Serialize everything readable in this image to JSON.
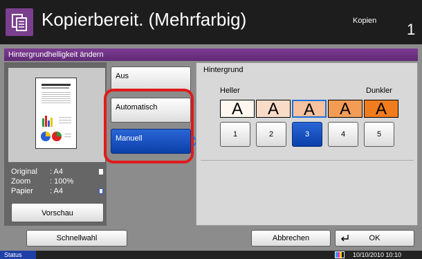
{
  "header": {
    "title": "Kopierbereit. (Mehrfarbig)",
    "mode_label": "Kopien",
    "count": "1"
  },
  "subtitle": "Hintergrundhelligkeit ändern",
  "preview_info": {
    "rows": [
      {
        "label": "Original",
        "value": ": A4"
      },
      {
        "label": "Zoom",
        "value": ": 100%"
      },
      {
        "label": "Papier",
        "value": ": A4"
      }
    ],
    "button": "Vorschau"
  },
  "options": [
    {
      "label": "Aus"
    },
    {
      "label": "Automatisch"
    },
    {
      "label": "Manuell",
      "selected": true
    }
  ],
  "background": {
    "title": "Hintergrund",
    "light_label": "Heller",
    "dark_label": "Dunkler",
    "letters": [
      "A",
      "A",
      "A",
      "A",
      "A"
    ],
    "levels": [
      "1",
      "2",
      "3",
      "4",
      "5"
    ],
    "selected_level": "3",
    "swatch_colors": [
      "#fff7f0",
      "#f8dcc8",
      "#f6c2a0",
      "#f39c56",
      "#f07c1e"
    ]
  },
  "bottom": {
    "quick": "Schnellwahl",
    "cancel": "Abbrechen",
    "ok": "OK"
  },
  "status": {
    "label": "Status",
    "datetime": "10/10/2010  10:10"
  }
}
